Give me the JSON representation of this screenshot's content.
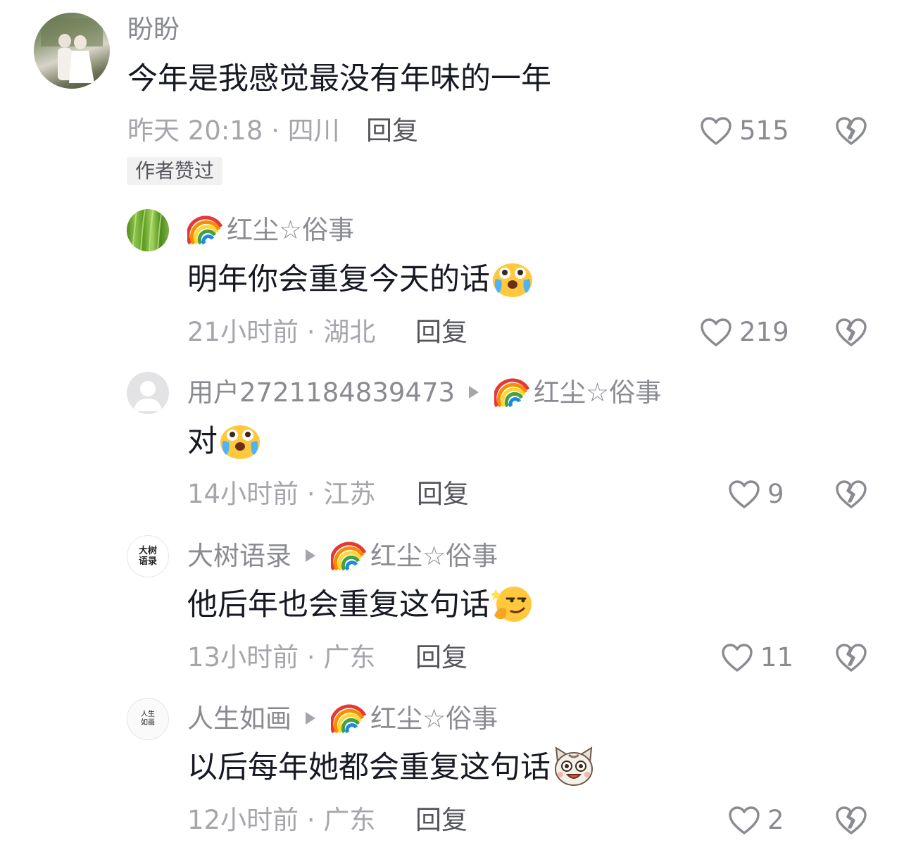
{
  "main_comment": {
    "author": "盼盼",
    "text": "今年是我感觉最没有年味的一年",
    "time_location": "昨天 20:18 · 四川",
    "reply_label": "回复",
    "like_count": "515",
    "badge": "作者赞过"
  },
  "replies": [
    {
      "author": "红尘☆俗事",
      "reply_to": "",
      "text": "明年你会重复今天的话",
      "time_location": "21小时前 · 湖北",
      "reply_label": "回复",
      "like_count": "219",
      "emoji": "crying-laughing-emoji"
    },
    {
      "author": "用户2721184839473",
      "reply_to": "红尘☆俗事",
      "text": "对",
      "time_location": "14小时前 · 江苏",
      "reply_label": "回复",
      "like_count": "9",
      "emoji": "crying-laughing-emoji"
    },
    {
      "author": "大树语录",
      "reply_to": "红尘☆俗事",
      "text": "他后年也会重复这句话",
      "time_location": "13小时前 · 广东",
      "reply_label": "回复",
      "like_count": "11",
      "emoji": "thinking-smirk-emoji"
    },
    {
      "author": "人生如画",
      "reply_to": "红尘☆俗事",
      "text": "以后每年她都会重复这句话",
      "time_location": "12小时前 · 广东",
      "reply_label": "回复",
      "like_count": "2",
      "emoji": "cat-face-emoji"
    }
  ],
  "avatars": {
    "r2": "大树\n语录",
    "r3": "人生如画"
  },
  "colors": {
    "nickname": "#8a8b91",
    "meta": "#a5a6ab",
    "text": "#161823"
  }
}
